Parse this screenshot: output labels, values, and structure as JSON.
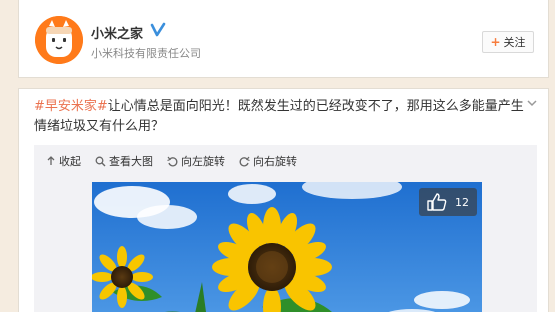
{
  "profile": {
    "name": "小米之家",
    "company": "小米科技有限责任公司",
    "follow_label": "关注",
    "follow_plus": "+"
  },
  "post": {
    "hashtag": "#早安米家#",
    "text": "让心情总是面向阳光！既然发生过的已经改变不了，那用这么多能量产生情绪垃圾又有什么用？",
    "toolbar": {
      "collapse": "收起",
      "view_large": "查看大图",
      "rotate_left": "向左旋转",
      "rotate_right": "向右旋转"
    },
    "likes": "12"
  },
  "colors": {
    "accent": "#eb7350",
    "brand_orange": "#ff7a1a",
    "verified_blue": "#3b8fdc"
  }
}
